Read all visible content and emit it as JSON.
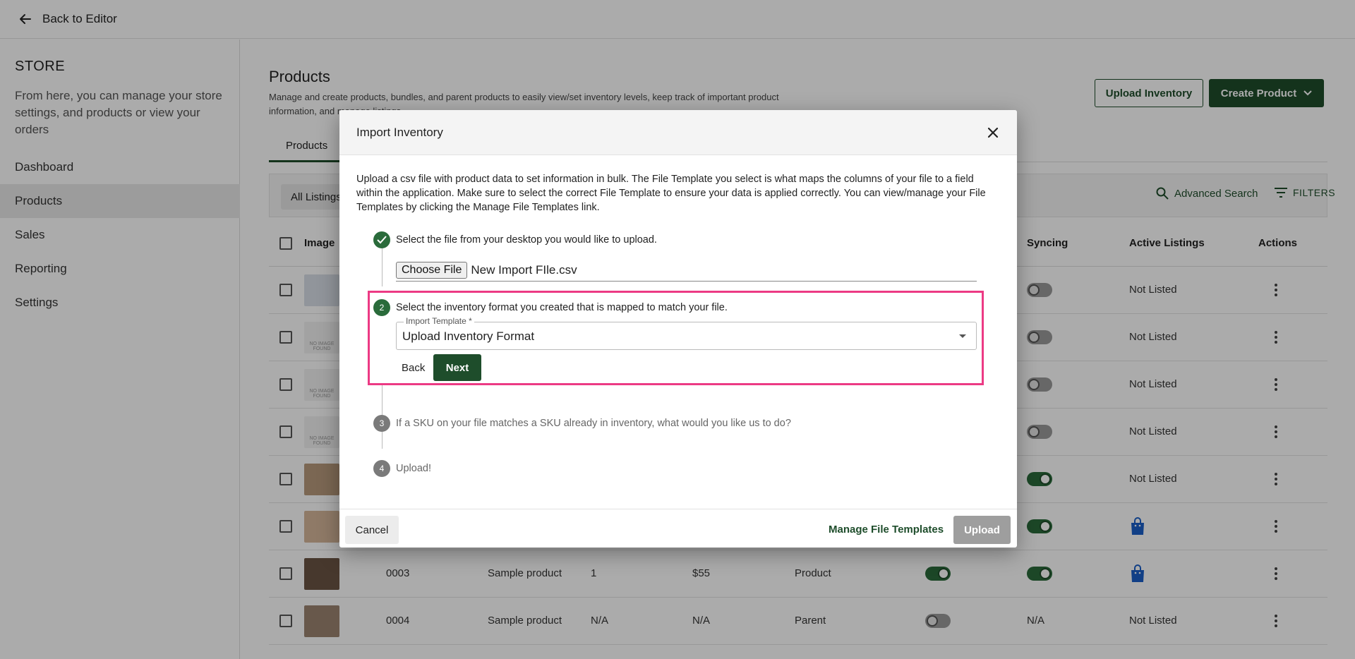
{
  "topbar": {
    "back_label": "Back to Editor"
  },
  "sidebar": {
    "title": "STORE",
    "description": "From here, you can manage your store settings, and products or view your orders",
    "items": [
      {
        "label": "Dashboard"
      },
      {
        "label": "Products"
      },
      {
        "label": "Sales"
      },
      {
        "label": "Reporting"
      },
      {
        "label": "Settings"
      }
    ]
  },
  "main": {
    "title": "Products",
    "description": "Manage and create products, bundles, and parent products to easily view/set inventory levels, keep track of important product information, and manage listings.",
    "upload_inventory_label": "Upload Inventory",
    "create_product_label": "Create Product",
    "tab_products": "Products",
    "all_listings": "All Listings",
    "advanced_search": "Advanced Search",
    "filters": "FILTERS",
    "columns": {
      "image": "Image",
      "syncing": "Syncing",
      "active_listings": "Active Listings",
      "actions": "Actions"
    },
    "rows": [
      {
        "sku": "",
        "name": "",
        "qty": "",
        "price": "",
        "type": "",
        "syncing": "off",
        "listing": "Not Listed"
      },
      {
        "sku": "",
        "name": "",
        "qty": "",
        "price": "",
        "type": "",
        "syncing": "off",
        "listing": "Not Listed"
      },
      {
        "sku": "",
        "name": "",
        "qty": "",
        "price": "",
        "type": "",
        "syncing": "off",
        "listing": "Not Listed"
      },
      {
        "sku": "",
        "name": "",
        "qty": "",
        "price": "",
        "type": "",
        "syncing": "off",
        "listing": "Not Listed"
      },
      {
        "sku": "",
        "name": "",
        "qty": "",
        "price": "",
        "type": "",
        "syncing": "on",
        "listing": "Not Listed"
      },
      {
        "sku": "",
        "name": "",
        "qty": "",
        "price": "",
        "type": "",
        "syncing": "on",
        "listing": "bag"
      },
      {
        "sku": "0003",
        "name": "Sample product",
        "qty": "1",
        "price": "$55",
        "type": "Product",
        "syncing": "on",
        "listing": "bag"
      },
      {
        "sku": "0004",
        "name": "Sample product",
        "qty": "N/A",
        "price": "N/A",
        "type": "Parent",
        "syncing": "N/A",
        "listing": "Not Listed"
      }
    ],
    "no_image_text": "NO IMAGE FOUND"
  },
  "modal": {
    "title": "Import Inventory",
    "intro": "Upload a csv file with product data to set information in bulk. The File Template you select is what maps the columns of your file to a field within the application. Make sure to select the correct File Template to ensure your data is applied correctly. You can view/manage your File Templates by clicking the Manage File Templates link.",
    "step1_label": "Select the file from your desktop you would like to upload.",
    "choose_file_label": "Choose File",
    "file_name": "New Import FIle.csv",
    "step2_number": "2",
    "step2_label": "Select the inventory format you created that is mapped to match your file.",
    "import_template_label": "Import Template *",
    "import_template_value": "Upload Inventory Format",
    "back_label": "Back",
    "next_label": "Next",
    "step3_number": "3",
    "step3_label": "If a SKU on your file matches a SKU already in inventory, what would you like us to do?",
    "step4_number": "4",
    "step4_label": "Upload!",
    "cancel_label": "Cancel",
    "manage_templates_label": "Manage File Templates",
    "upload_label": "Upload"
  },
  "colors": {
    "brand": "#1e4d2b",
    "highlight": "#ec3a84",
    "listing_bag": "#1a5fc8"
  }
}
